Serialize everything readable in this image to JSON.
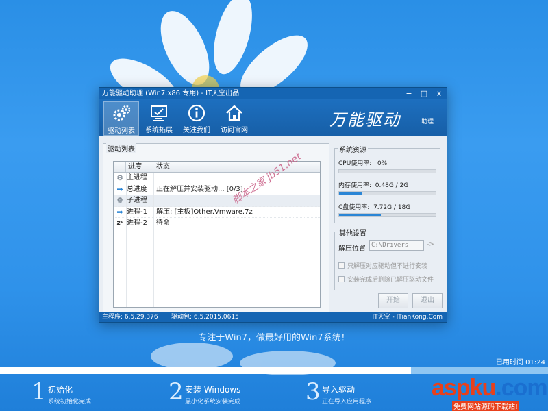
{
  "window": {
    "title": "万能驱动助理 (Win7.x86 专用) - IT天空出品",
    "controls": [
      "−",
      "□",
      "×"
    ]
  },
  "toolbar": {
    "items": [
      {
        "label": "驱动列表",
        "icon": "gears-icon",
        "active": true
      },
      {
        "label": "系统拓展",
        "icon": "monitor-icon",
        "active": false
      },
      {
        "label": "关注我们",
        "icon": "info-icon",
        "active": false
      },
      {
        "label": "访问官网",
        "icon": "home-icon",
        "active": false
      }
    ],
    "brand": "万能驱动",
    "brand_sub": "助理"
  },
  "driver_list": {
    "title": "驱动列表",
    "columns": [
      "进度",
      "状态"
    ],
    "rows": [
      {
        "icon": "gear-icon",
        "progress": "主进程",
        "status": ""
      },
      {
        "icon": "arrow-right-icon",
        "progress": "总进度",
        "status": "正在解压并安装驱动... [0/3]"
      },
      {
        "icon": "gear-icon",
        "progress": "子进程",
        "status": ""
      },
      {
        "icon": "arrow-right-icon",
        "progress": "进程-1",
        "status": "解压: [主板]Other.Vmware.7z"
      },
      {
        "icon": "sleep-icon",
        "progress": "进程-2",
        "status": "待命"
      }
    ]
  },
  "resources": {
    "title": "系统资源",
    "cpu": {
      "label": "CPU使用率:",
      "value": "0%",
      "fraction": 0.0
    },
    "memory": {
      "label": "内存使用率:",
      "value": "0.48G / 2G",
      "fraction": 0.24
    },
    "disk": {
      "label": "C盘使用率:",
      "value": "7.72G / 18G",
      "fraction": 0.43
    }
  },
  "settings": {
    "title": "其他设置",
    "extract_label": "解压位置",
    "extract_path": "C:\\Drivers",
    "go": "->",
    "option1": "只解压对应驱动但不进行安装",
    "option2": "安装完成后删除已解压驱动文件"
  },
  "buttons": {
    "start": "开始",
    "exit": "退出"
  },
  "statusbar": {
    "main_label": "主程序:",
    "main_version": "6.5.29.376",
    "pack_label": "驱动包:",
    "pack_version": "6.5.2015.0615",
    "right": "IT天空 - ITianKong.Com"
  },
  "desktop": {
    "slogan": "专注于Win7，做最好用的Win7系统！",
    "elapsed": "已用时间 01:24",
    "progress_fraction": 0.75,
    "steps": [
      {
        "num": "1",
        "title": "初始化",
        "sub": "系统初始化完成"
      },
      {
        "num": "2",
        "title": "安装 Windows",
        "sub": "最小化系统安装完成"
      },
      {
        "num": "3",
        "title": "导入驱动",
        "sub": "正在导入应用程序"
      }
    ]
  },
  "watermark": {
    "site": "脚本之家 jb51.net",
    "logo": "aspku",
    "logo_suffix": ".com",
    "logo_sub": "免费网站源码下载站!"
  }
}
